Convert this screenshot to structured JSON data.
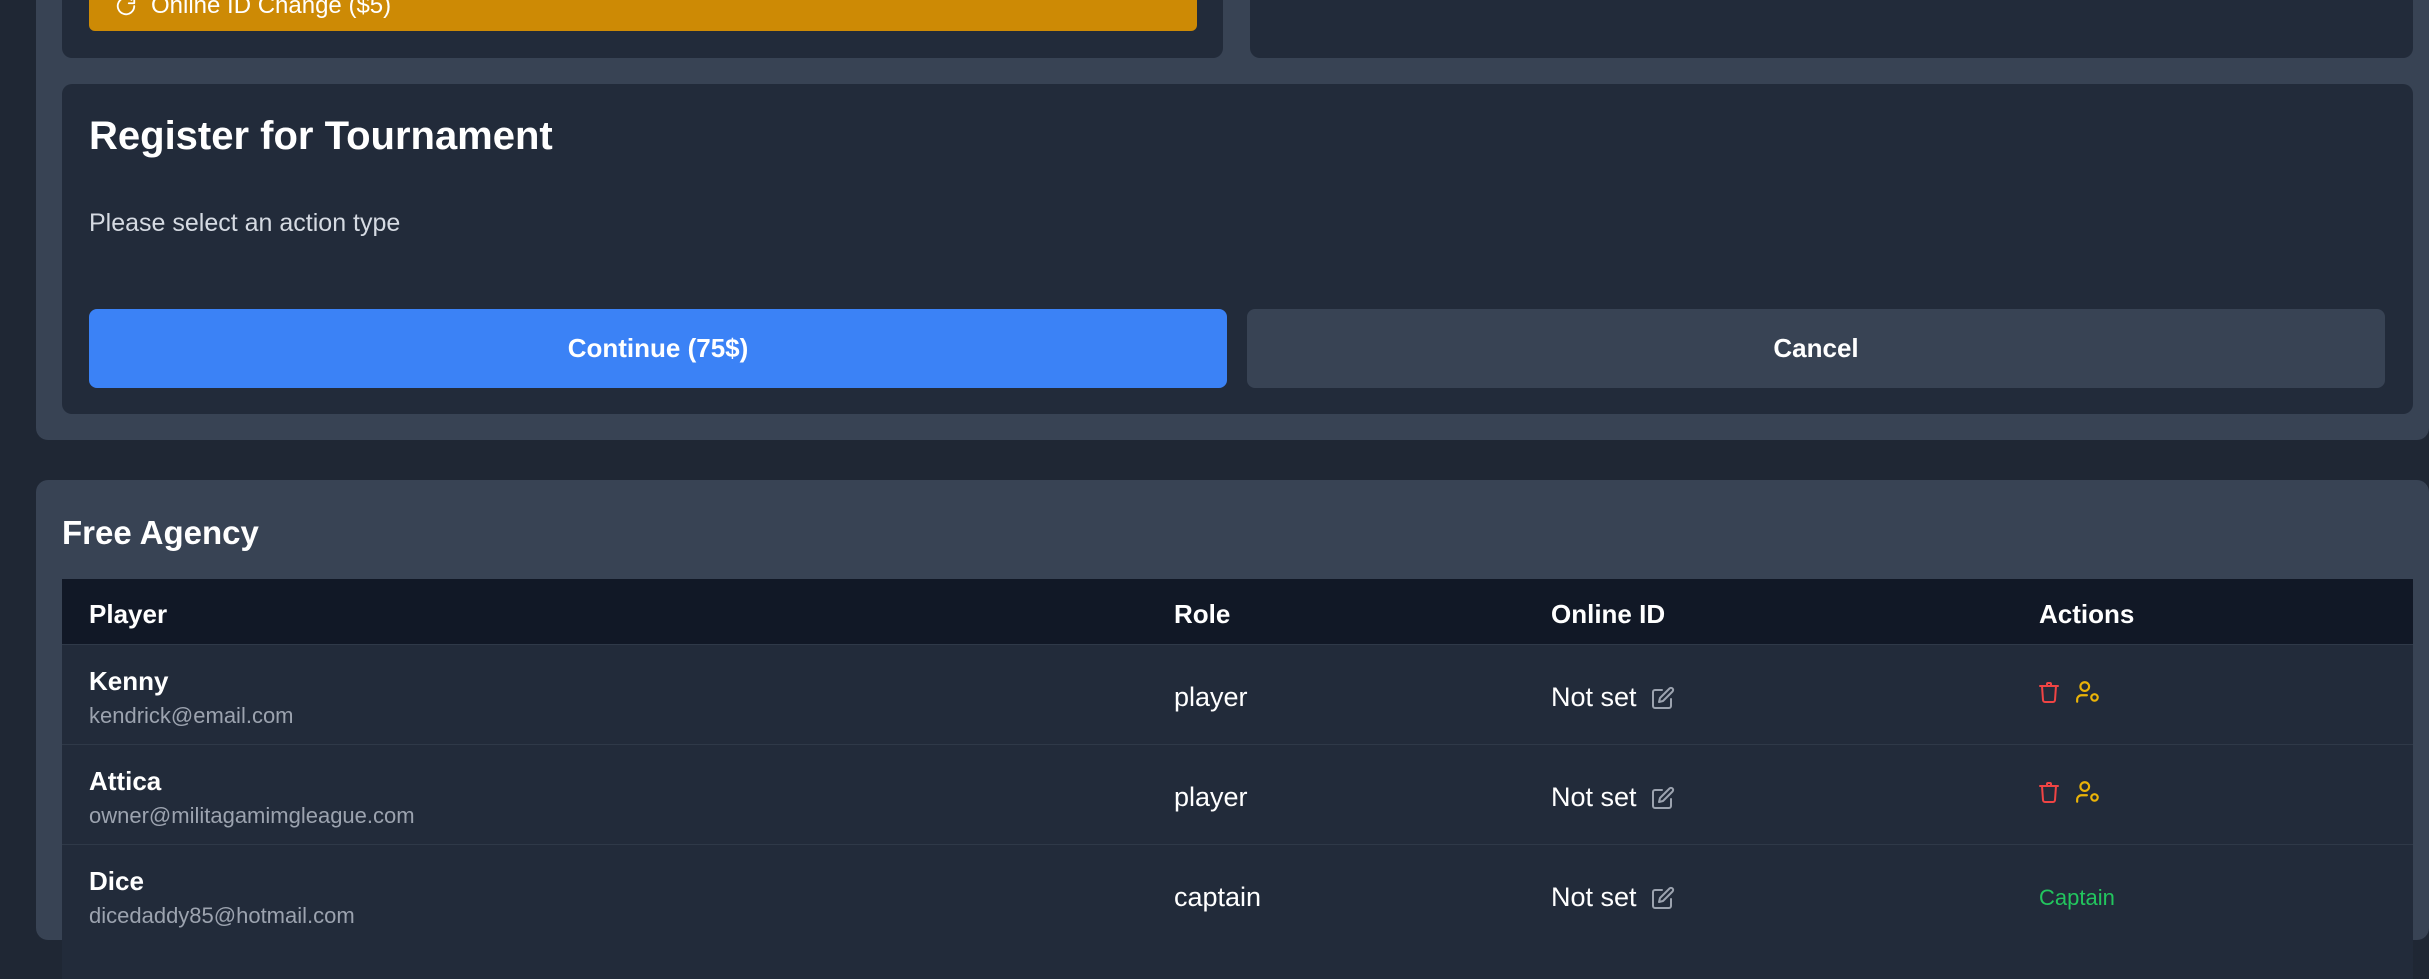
{
  "top_section": {
    "id_change_button": "Online ID Change ($5)"
  },
  "register": {
    "title": "Register for Tournament",
    "subtitle": "Please select an action type",
    "continue_label": "Continue (75$)",
    "cancel_label": "Cancel"
  },
  "free_agency": {
    "title": "Free Agency",
    "columns": [
      "Player",
      "Role",
      "Online ID",
      "Actions"
    ],
    "rows": [
      {
        "name": "Kenny",
        "email": "kendrick@email.com",
        "role": "player",
        "online_id": "Not set",
        "action": ""
      },
      {
        "name": "Attica",
        "email": "owner@militagamimgleague.com",
        "role": "player",
        "online_id": "Not set",
        "action": ""
      },
      {
        "name": "Dice",
        "email": "dicedaddy85@hotmail.com",
        "role": "captain",
        "online_id": "Not set",
        "action": "Captain"
      }
    ]
  },
  "icons": {
    "refresh": "refresh-icon",
    "edit": "edit-icon",
    "delete": "trash-icon",
    "promote": "user-cog-icon"
  },
  "colors": {
    "accent_blue": "#3b82f6",
    "warning_orange": "#cd8a05",
    "delete_red": "#ef4444",
    "promote_yellow": "#eab308",
    "captain_green": "#22c55e"
  }
}
